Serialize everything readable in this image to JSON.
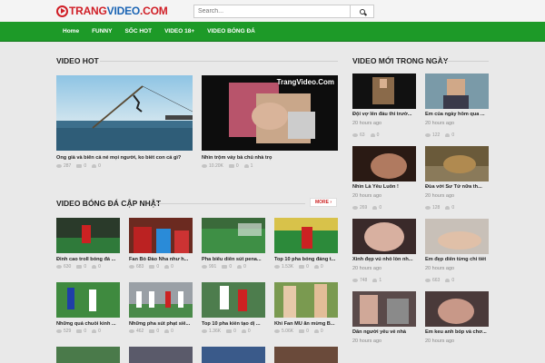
{
  "header": {
    "logo_prefix": "TRANG",
    "logo_mid": "VIDEO",
    "logo_suffix": ".COM",
    "search_placeholder": "Search..."
  },
  "nav": {
    "items": [
      "Home",
      "FUNNY",
      "SỐC HOT",
      "VIDEO 18+",
      "VIDEO BÓNG ĐÁ"
    ]
  },
  "hot": {
    "title": "VIDEO HOT",
    "items": [
      {
        "title": "Ông già và biển cả né mọi người, ko biết con cá gì?",
        "views": "287",
        "comments": "0",
        "likes": "0"
      },
      {
        "title": "Nhìn trộm váy bà chủ nhà trọ",
        "views": "10.20K",
        "comments": "0",
        "likes": "1",
        "watermark": "TrangVideo.Com"
      }
    ]
  },
  "football": {
    "title": "VIDEO BÓNG ĐÁ CẬP NHẬT",
    "more_label": "MORE ›",
    "items": [
      {
        "title": "Đỉnh cao troll bóng đá ...",
        "views": "630",
        "comments": "0",
        "likes": "0"
      },
      {
        "title": "Fan Bồ Đào Nha như h...",
        "views": "683",
        "comments": "0",
        "likes": "0"
      },
      {
        "title": "Pha biểu diễn sút pena...",
        "views": "991",
        "comments": "0",
        "likes": "0"
      },
      {
        "title": "Top 10 pha bóng đáng t...",
        "views": "1.53K",
        "comments": "0",
        "likes": "0"
      },
      {
        "title": "Những quả chuối kinh ...",
        "views": "529",
        "comments": "0",
        "likes": "0"
      },
      {
        "title": "Những pha sút phạt siê...",
        "views": "462",
        "comments": "0",
        "likes": "0"
      },
      {
        "title": "Top 10 pha kiến tạo dị ...",
        "views": "1.36K",
        "comments": "0",
        "likes": "0"
      },
      {
        "title": "Khi Fan MU ăn mừng B...",
        "views": "5.06K",
        "comments": "0",
        "likes": "0"
      }
    ]
  },
  "latest": {
    "title": "VIDEO MỚI TRONG NGÀY",
    "items": [
      {
        "title": "Đội vợ lên đầu thi trườ...",
        "time": "20 hours ago",
        "views": "63",
        "likes": "0"
      },
      {
        "title": "Em của ngày hôm qua ...",
        "time": "20 hours ago",
        "views": "122",
        "likes": "0"
      },
      {
        "title": "Nhìn Là Yêu Luôn !",
        "time": "20 hours ago",
        "views": "269",
        "likes": "0"
      },
      {
        "title": "Đùa với Sư Tử nữa th...",
        "time": "20 hours ago",
        "views": "128",
        "likes": "0"
      },
      {
        "title": "Xinh đẹp vú nhỏ lồn nh...",
        "time": "20 hours ago",
        "views": "748",
        "likes": "1"
      },
      {
        "title": "Em đẹp diễn từng chi tiết",
        "time": "20 hours ago",
        "views": "663",
        "likes": "0"
      },
      {
        "title": "Dẫn người yêu về nhà",
        "time": "20 hours ago",
        "views": "",
        "likes": ""
      },
      {
        "title": "Em keu anh bóp và chơ...",
        "time": "20 hours ago",
        "views": "",
        "likes": ""
      }
    ]
  },
  "colors": {
    "nav_green": "#1d9a28",
    "logo_blue": "#1a64b4",
    "logo_red": "#d01e26"
  }
}
